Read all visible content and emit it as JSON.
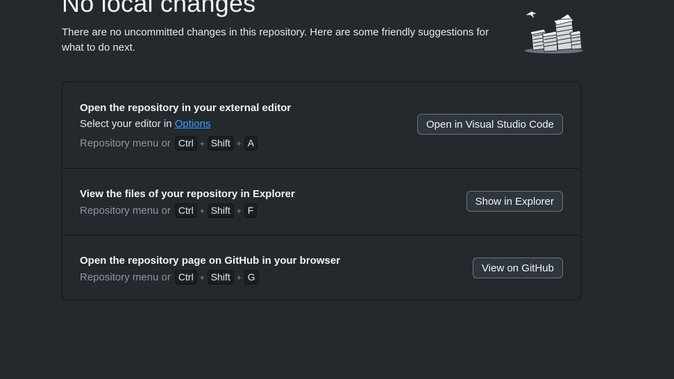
{
  "header": {
    "title": "No local changes",
    "subtitle": "There are no uncommitted changes in this repository. Here are some friendly suggestions for what to do next."
  },
  "illustration": {
    "icon": "paper-stacks-illustration"
  },
  "suggestions": [
    {
      "title": "Open the repository in your external editor",
      "description_prefix": "Select your editor in ",
      "description_link": "Options",
      "shortcut_prefix": "Repository menu or",
      "keys": [
        "Ctrl",
        "Shift",
        "A"
      ],
      "plus": "+",
      "button_label": "Open in Visual Studio Code"
    },
    {
      "title": "View the files of your repository in Explorer",
      "shortcut_prefix": "Repository menu or",
      "keys": [
        "Ctrl",
        "Shift",
        "F"
      ],
      "plus": "+",
      "button_label": "Show in Explorer"
    },
    {
      "title": "Open the repository page on GitHub in your browser",
      "shortcut_prefix": "Repository menu or",
      "keys": [
        "Ctrl",
        "Shift",
        "G"
      ],
      "plus": "+",
      "button_label": "View on GitHub"
    }
  ],
  "colors": {
    "background": "#24292e",
    "link": "#3f9bff",
    "muted_text": "#8b949e",
    "border": "#141719"
  }
}
